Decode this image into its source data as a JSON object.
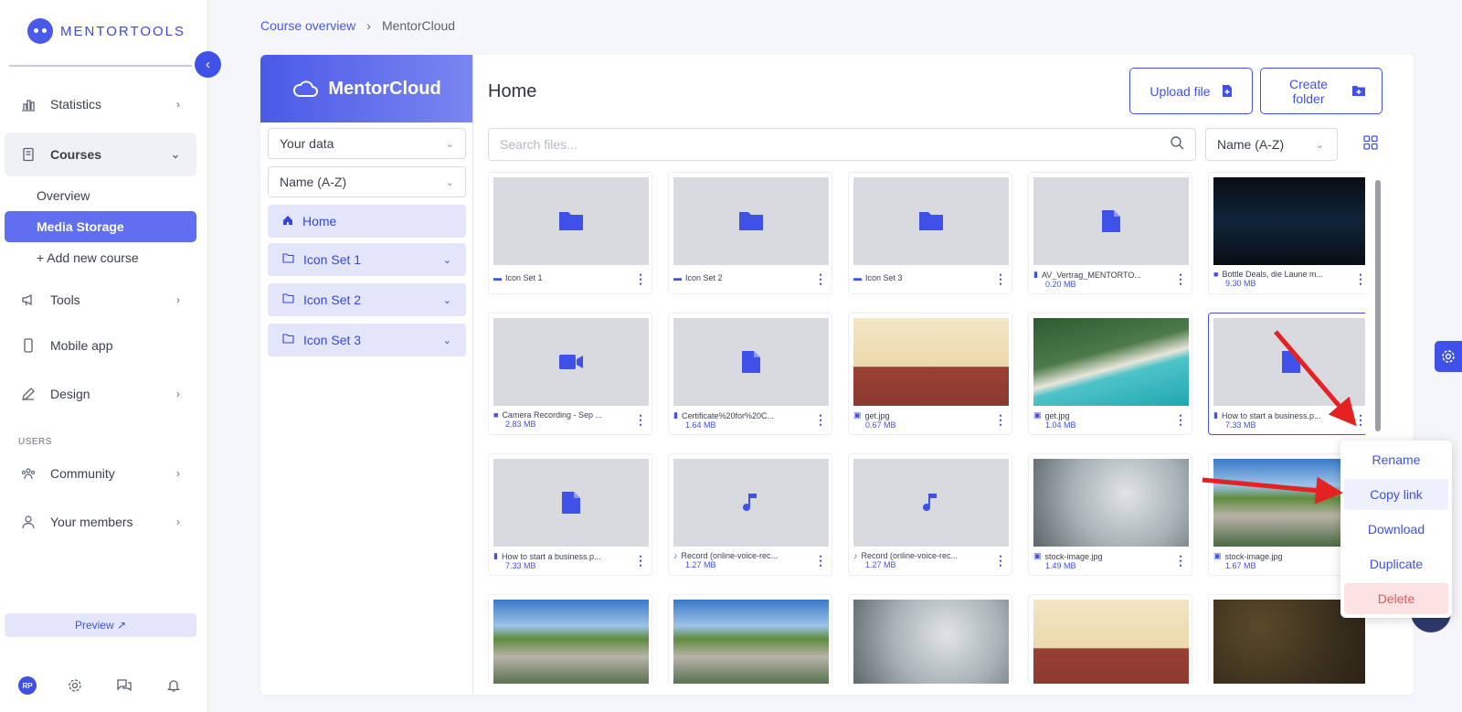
{
  "brand": {
    "name": "MENTORTOOLS"
  },
  "sidebar": {
    "items": [
      {
        "label": "Statistics"
      },
      {
        "label": "Courses"
      },
      {
        "label": "Tools"
      },
      {
        "label": "Mobile app"
      },
      {
        "label": "Design"
      },
      {
        "label": "Community"
      },
      {
        "label": "Your members"
      }
    ],
    "courses_sub": [
      {
        "label": "Overview"
      },
      {
        "label": "Media Storage"
      },
      {
        "label": "+ Add new course"
      }
    ],
    "section_users": "USERS",
    "preview_label": "Preview ↗",
    "avatar_initials": "RP"
  },
  "breadcrumb": {
    "parent": "Course overview",
    "separator": "›",
    "current": "MentorCloud"
  },
  "cloud": {
    "title": "MentorCloud",
    "data_select": "Your data",
    "sort_select": "Name (A-Z)",
    "tree": [
      {
        "label": "Home"
      },
      {
        "label": "Icon Set 1"
      },
      {
        "label": "Icon Set 2"
      },
      {
        "label": "Icon Set 3"
      }
    ]
  },
  "files": {
    "title": "Home",
    "upload_label": "Upload file",
    "create_folder_label": "Create folder",
    "search_placeholder": "Search files...",
    "sort_label": "Name (A-Z)",
    "tiles": [
      {
        "name": "Icon Set 1",
        "size": "",
        "kind": "folder"
      },
      {
        "name": "Icon Set 2",
        "size": "",
        "kind": "folder"
      },
      {
        "name": "Icon Set 3",
        "size": "",
        "kind": "folder"
      },
      {
        "name": "AV_Vertrag_MENTORTO...",
        "size": "0.20 MB",
        "kind": "doc"
      },
      {
        "name": "Bottle Deals, die Laune m...",
        "size": "9.30 MB",
        "kind": "video-image"
      },
      {
        "name": "Camera Recording - Sep ...",
        "size": "2.83 MB",
        "kind": "video"
      },
      {
        "name": "Certificate%20for%20C...",
        "size": "1.64 MB",
        "kind": "doc"
      },
      {
        "name": "get.jpg",
        "size": "0.67 MB",
        "kind": "img-bird"
      },
      {
        "name": "get.jpg",
        "size": "1.04 MB",
        "kind": "img-beach"
      },
      {
        "name": "How to start a business.p...",
        "size": "7.33 MB",
        "kind": "doc"
      },
      {
        "name": "How to start a business.p...",
        "size": "7.33 MB",
        "kind": "doc"
      },
      {
        "name": "Record (online-voice-rec...",
        "size": "1.27 MB",
        "kind": "audio"
      },
      {
        "name": "Record (online-voice-rec...",
        "size": "1.27 MB",
        "kind": "audio"
      },
      {
        "name": "stock-image.jpg",
        "size": "1.49 MB",
        "kind": "img-clouds"
      },
      {
        "name": "stock-image.jpg",
        "size": "1.67 MB",
        "kind": "img-stones"
      },
      {
        "name": "",
        "size": "",
        "kind": "img-stones"
      },
      {
        "name": "",
        "size": "",
        "kind": "img-stones"
      },
      {
        "name": "",
        "size": "",
        "kind": "img-clouds"
      },
      {
        "name": "",
        "size": "",
        "kind": "img-bird"
      },
      {
        "name": "",
        "size": "",
        "kind": "img-leaves"
      }
    ]
  },
  "context_menu": {
    "items": [
      {
        "label": "Rename"
      },
      {
        "label": "Copy link"
      },
      {
        "label": "Download"
      },
      {
        "label": "Duplicate"
      },
      {
        "label": "Delete"
      }
    ]
  },
  "colors": {
    "accent": "#3f51e8",
    "danger": "#e05a5f",
    "arrow": "#e52222"
  }
}
